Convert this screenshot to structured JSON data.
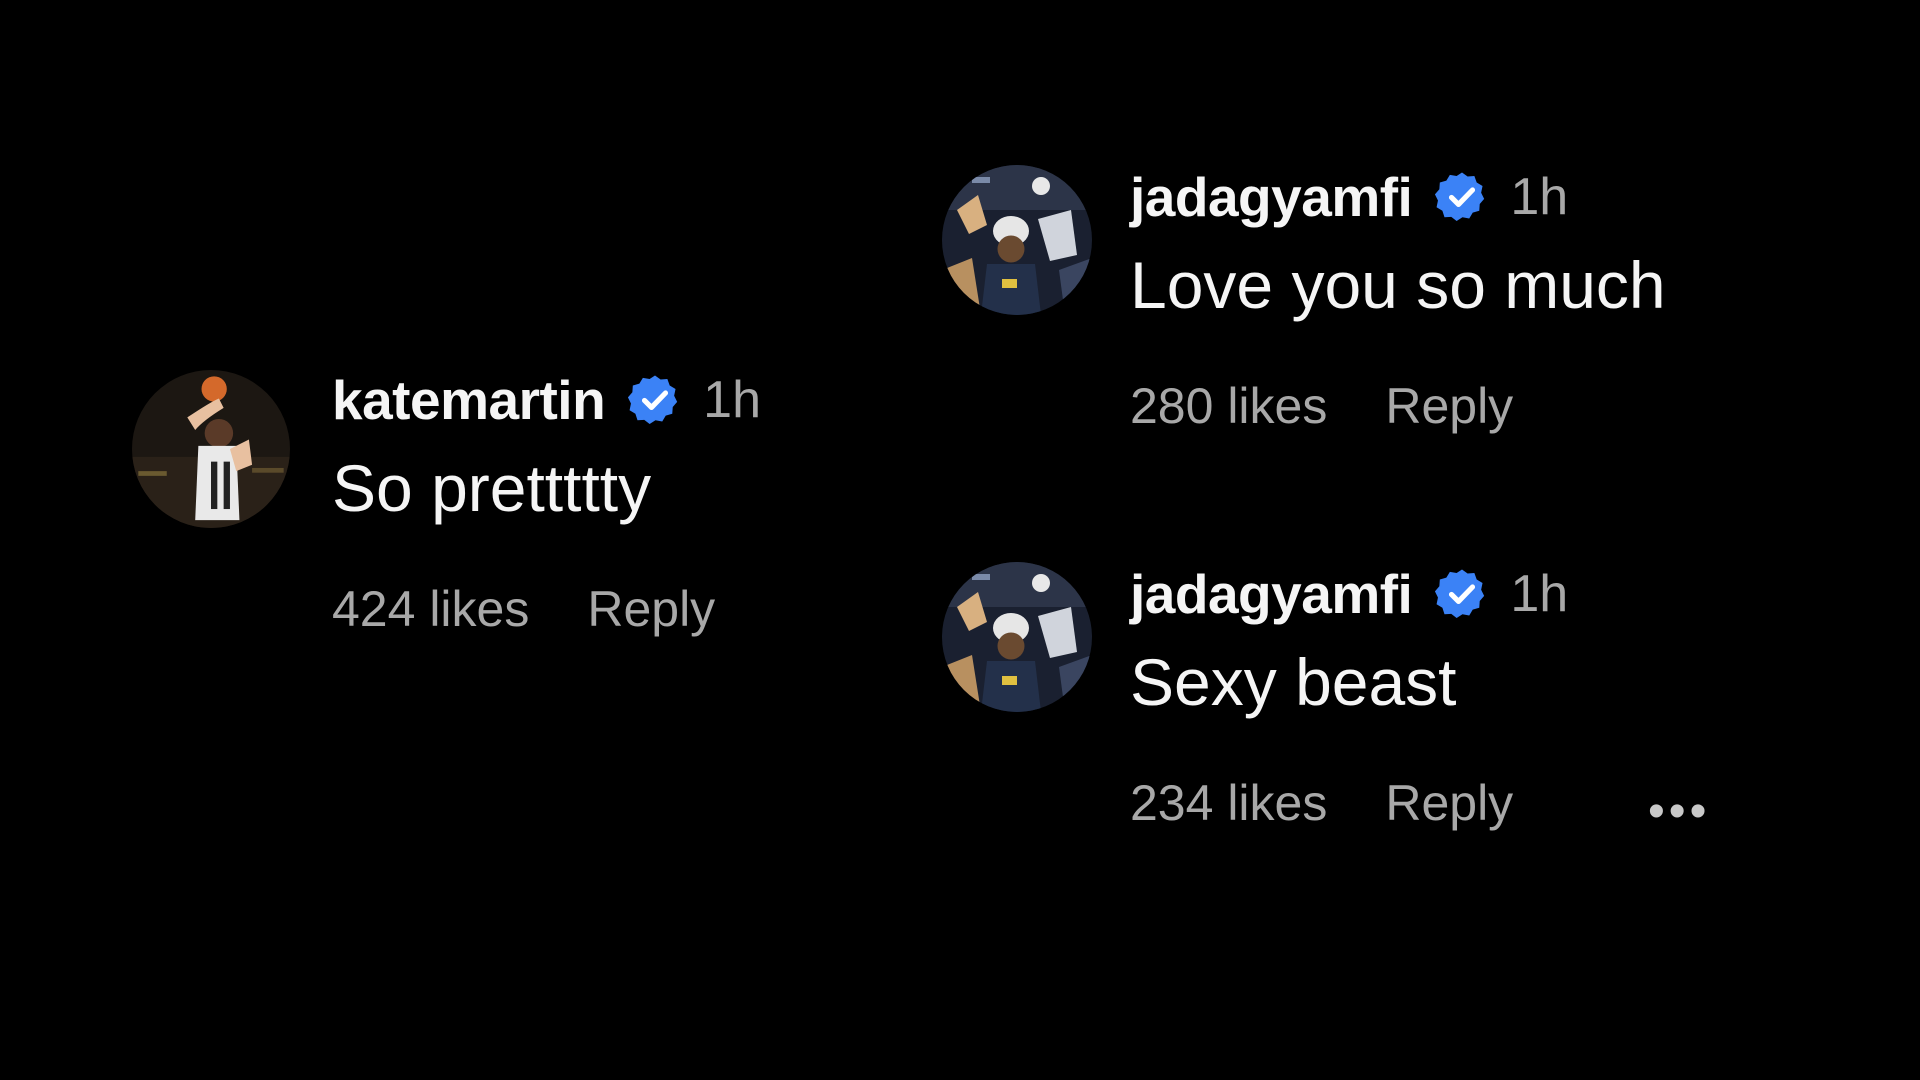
{
  "comments": [
    {
      "username": "katemartin",
      "time": "1h",
      "text": "So prettttty",
      "likes": "424 likes",
      "reply": "Reply",
      "verified": true
    },
    {
      "username": "jadagyamfi",
      "time": "1h",
      "text": "Love you so much",
      "likes": "280 likes",
      "reply": "Reply",
      "verified": true
    },
    {
      "username": "jadagyamfi",
      "time": "1h",
      "text": "Sexy beast",
      "likes": "234 likes",
      "reply": "Reply",
      "verified": true
    }
  ],
  "more_options": "•••",
  "colors": {
    "background": "#000000",
    "text_primary": "#f5f5f5",
    "text_secondary": "#a8a8a8",
    "verified_badge": "#3b82f6"
  },
  "icons": {
    "verified": "verified-badge-icon",
    "more": "more-options-icon"
  }
}
